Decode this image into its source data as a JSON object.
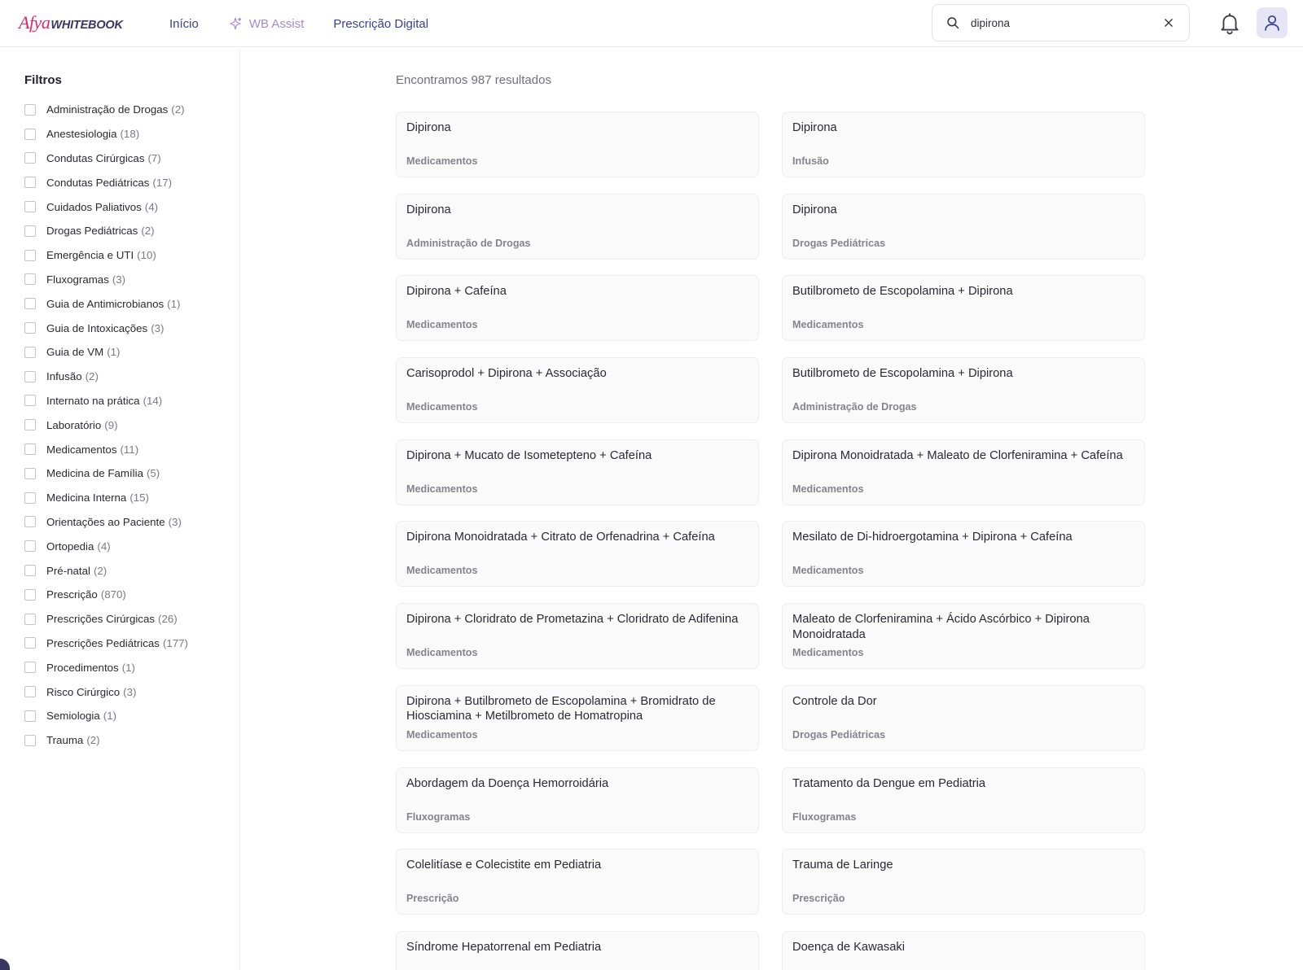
{
  "header": {
    "logo": {
      "brand": "Afya",
      "product": "WHITEBOOK"
    },
    "nav": [
      {
        "label": "Início",
        "icon": ""
      },
      {
        "label": "WB Assist",
        "icon": "sparkle-icon"
      },
      {
        "label": "Prescrição Digital",
        "icon": ""
      }
    ],
    "search": {
      "value": "dipirona",
      "icon": "search-icon",
      "clear_icon": "close-icon"
    },
    "notifications_icon": "bell-icon",
    "profile_icon": "user-icon"
  },
  "colors": {
    "brand_pink": "#e0286a",
    "brand_navy": "#3a3660",
    "nav_link": "#3a3f8f",
    "assist_purple": "#a58ad1"
  },
  "sidebar": {
    "title": "Filtros",
    "filters": [
      {
        "label": "Administração de Drogas",
        "count": "(2)"
      },
      {
        "label": "Anestesiologia",
        "count": "(18)"
      },
      {
        "label": "Condutas Cirúrgicas",
        "count": "(7)"
      },
      {
        "label": "Condutas Pediátricas",
        "count": "(17)"
      },
      {
        "label": "Cuidados Paliativos",
        "count": "(4)"
      },
      {
        "label": "Drogas Pediátricas",
        "count": "(2)"
      },
      {
        "label": "Emergência e UTI",
        "count": "(10)"
      },
      {
        "label": "Fluxogramas",
        "count": "(3)"
      },
      {
        "label": "Guia de Antimicrobianos",
        "count": "(1)"
      },
      {
        "label": "Guia de Intoxicações",
        "count": "(3)"
      },
      {
        "label": "Guia de VM",
        "count": "(1)"
      },
      {
        "label": "Infusão",
        "count": "(2)"
      },
      {
        "label": "Internato na prática",
        "count": "(14)"
      },
      {
        "label": "Laboratório",
        "count": "(9)"
      },
      {
        "label": "Medicamentos",
        "count": "(11)"
      },
      {
        "label": "Medicina de Família",
        "count": "(5)"
      },
      {
        "label": "Medicina Interna",
        "count": "(15)"
      },
      {
        "label": "Orientações ao Paciente",
        "count": "(3)"
      },
      {
        "label": "Ortopedia",
        "count": "(4)"
      },
      {
        "label": "Pré-natal",
        "count": "(2)"
      },
      {
        "label": "Prescrição",
        "count": "(870)"
      },
      {
        "label": "Prescrições Cirúrgicas",
        "count": "(26)"
      },
      {
        "label": "Prescrições Pediátricas",
        "count": "(177)"
      },
      {
        "label": "Procedimentos",
        "count": "(1)"
      },
      {
        "label": "Risco Cirúrgico",
        "count": "(3)"
      },
      {
        "label": "Semiologia",
        "count": "(1)"
      },
      {
        "label": "Trauma",
        "count": "(2)"
      }
    ]
  },
  "results": {
    "summary": "Encontramos 987 resultados",
    "items": [
      {
        "title": "Dipirona",
        "category": "Medicamentos"
      },
      {
        "title": "Dipirona",
        "category": "Infusão"
      },
      {
        "title": "Dipirona",
        "category": "Administração de Drogas"
      },
      {
        "title": "Dipirona",
        "category": "Drogas Pediátricas"
      },
      {
        "title": "Dipirona + Cafeína",
        "category": "Medicamentos"
      },
      {
        "title": "Butilbrometo de Escopolamina + Dipirona",
        "category": "Medicamentos"
      },
      {
        "title": "Carisoprodol + Dipirona + Associação",
        "category": "Medicamentos"
      },
      {
        "title": "Butilbrometo de Escopolamina + Dipirona",
        "category": "Administração de Drogas"
      },
      {
        "title": "Dipirona + Mucato de Isometepteno + Cafeína",
        "category": "Medicamentos"
      },
      {
        "title": "Dipirona Monoidratada + Maleato de Clorfeniramina + Cafeína",
        "category": "Medicamentos"
      },
      {
        "title": "Dipirona Monoidratada + Citrato de Orfenadrina + Cafeína",
        "category": "Medicamentos"
      },
      {
        "title": "Mesilato de Di-hidroergotamina + Dipirona + Cafeína",
        "category": "Medicamentos"
      },
      {
        "title": "Dipirona + Cloridrato de Prometazina + Cloridrato de Adifenina",
        "category": "Medicamentos"
      },
      {
        "title": "Maleato de Clorfeniramina + Ácido Ascórbico + Dipirona Monoidratada",
        "category": "Medicamentos"
      },
      {
        "title": "Dipirona + Butilbrometo de Escopolamina + Bromidrato de Hiosciamina + Metilbrometo de Homatropina",
        "category": "Medicamentos"
      },
      {
        "title": "Controle da Dor",
        "category": "Drogas Pediátricas"
      },
      {
        "title": "Abordagem da Doença Hemorroidária",
        "category": "Fluxogramas"
      },
      {
        "title": "Tratamento da Dengue em Pediatria",
        "category": "Fluxogramas"
      },
      {
        "title": "Colelitíase e Colecistite em Pediatria",
        "category": "Prescrição"
      },
      {
        "title": "Trauma de Laringe",
        "category": "Prescrição"
      },
      {
        "title": "Síndrome Hepatorrenal em Pediatria",
        "category": ""
      },
      {
        "title": "Doença de Kawasaki",
        "category": ""
      }
    ]
  }
}
